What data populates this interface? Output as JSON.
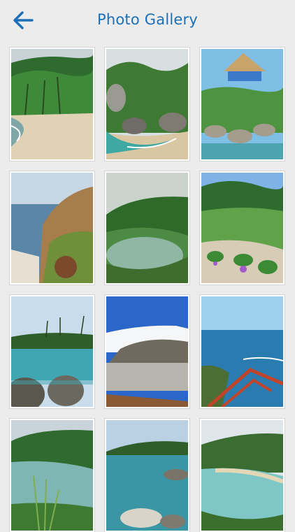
{
  "header": {
    "title": "Photo Gallery",
    "back_icon": "back-arrow-icon",
    "accent": "#1d6fb8"
  },
  "gallery": {
    "photos": [
      {
        "subject": "palm-beach"
      },
      {
        "subject": "boulder-cove"
      },
      {
        "subject": "thatched-hut-rocks"
      },
      {
        "subject": "cliff-sea-view"
      },
      {
        "subject": "lagoon-bay"
      },
      {
        "subject": "morning-glory-beach"
      },
      {
        "subject": "palm-coast-rocks"
      },
      {
        "subject": "wave-over-rocks"
      },
      {
        "subject": "ocean-from-deck"
      },
      {
        "subject": "agave-bay"
      },
      {
        "subject": "rocky-bay"
      },
      {
        "subject": "curved-bay"
      }
    ]
  }
}
